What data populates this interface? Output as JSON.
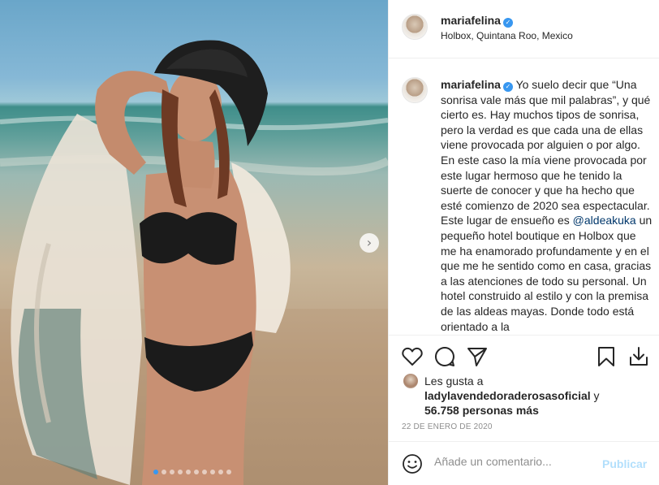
{
  "post": {
    "username": "mariafelina",
    "location": "Holbox, Quintana Roo, Mexico",
    "verified_icon": "verified-badge-icon",
    "carousel": {
      "next_icon": "chevron-right-icon",
      "slide_count": 10,
      "active_slide": 1
    }
  },
  "caption": {
    "username": "mariafelina",
    "text_before": "Yo suelo decir que “Una sonrisa vale más que mil palabras”, y qué cierto es. Hay muchos tipos de sonrisa, pero la verdad es que cada una de ellas viene provocada por alguien o por algo. En este caso la mía viene provocada por este lugar hermoso que he tenido la suerte de conocer y que ha hecho que esté comienzo de 2020 sea espectacular. Este lugar de ensueño es",
    "mention": "@aldeakuka",
    "text_after": "un pequeño hotel boutique en Holbox que me ha enamorado profundamente y en el que me he sentido como en casa, gracias a las atenciones de todo su personal. Un hotel construido al estilo y con la premisa de las aldeas mayas. Donde todo está orientado a la"
  },
  "actions": {
    "like_icon": "heart-icon",
    "comment_icon": "comment-icon",
    "share_icon": "paper-plane-icon",
    "save_icon": "bookmark-icon",
    "download_icon": "download-icon"
  },
  "likes": {
    "prefix": "Les gusta a",
    "user": "ladylavendedoraderosasoficial",
    "connector": "y",
    "others": "56.758 personas más"
  },
  "date": "22 DE ENERO DE 2020",
  "comment": {
    "placeholder": "Añade un comentario...",
    "emoji_icon": "smiley-icon",
    "publish_label": "Publicar"
  },
  "colors": {
    "verified": "#3897f0",
    "mention": "#00376b",
    "publish_disabled": "#b2dffc",
    "secondary_text": "#8e8e8e",
    "divider": "#efefef"
  }
}
